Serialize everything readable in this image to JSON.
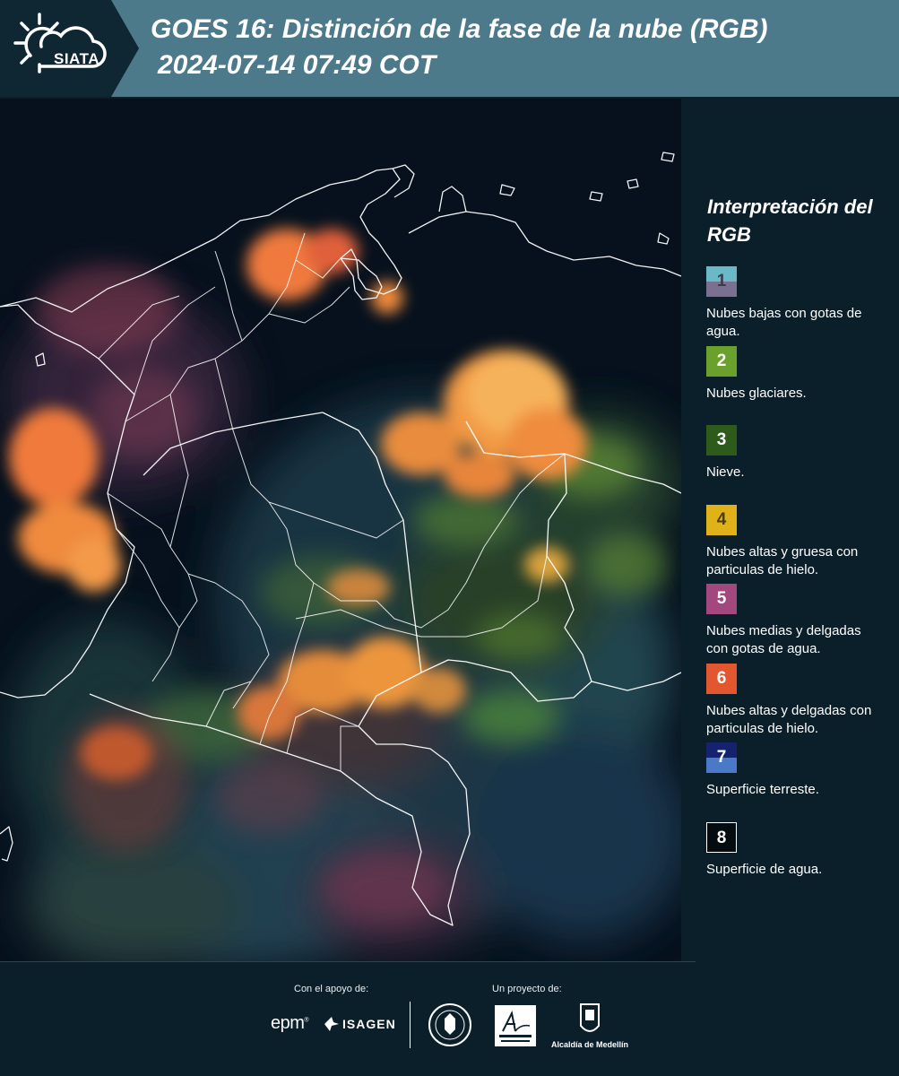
{
  "header": {
    "logo_text": "SIATA",
    "title": "GOES 16: Distinción de la fase de la nube (RGB)",
    "timestamp": "2024-07-14 07:49 COT"
  },
  "map": {
    "type": "satellite RGB composite",
    "background_color": "#05101c",
    "boundary_color": "#ffffff"
  },
  "legend": {
    "title": "Interpretación del RGB",
    "items": [
      {
        "number": "1",
        "label": "Nubes bajas con gotas de agua.",
        "colors": [
          "#6bb8c6",
          "#7a7190"
        ],
        "text_color": "#3b3b4a"
      },
      {
        "number": "2",
        "label": "Nubes glaciares.",
        "colors": [
          "#6aa12c"
        ],
        "text_color": "#ffffff"
      },
      {
        "number": "3",
        "label": "Nieve.",
        "colors": [
          "#2e5a1c"
        ],
        "text_color": "#ffffff"
      },
      {
        "number": "4",
        "label": "Nubes altas y gruesa con particulas de hielo.",
        "colors": [
          "#e0b21a"
        ],
        "text_color": "#4a3d10"
      },
      {
        "number": "5",
        "label": "Nubes medias y delgadas con gotas de agua.",
        "colors": [
          "#a3477f"
        ],
        "text_color": "#ffffff"
      },
      {
        "number": "6",
        "label": "Nubes altas y delgadas con particulas de hielo.",
        "colors": [
          "#e2572f"
        ],
        "text_color": "#ffffff"
      },
      {
        "number": "7",
        "label": "Superficie terreste.",
        "colors": [
          "#15236e",
          "#4a79c7"
        ],
        "text_color": "#ffffff"
      },
      {
        "number": "8",
        "label": "Superficie de agua.",
        "colors": [
          "#050c10"
        ],
        "text_color": "#ffffff"
      }
    ]
  },
  "footer": {
    "support_caption": "Con el apoyo de:",
    "project_caption": "Un proyecto de:",
    "epm": "epm",
    "isagen": "ISAGEN",
    "medellin": "Alcaldía de Medellín"
  }
}
